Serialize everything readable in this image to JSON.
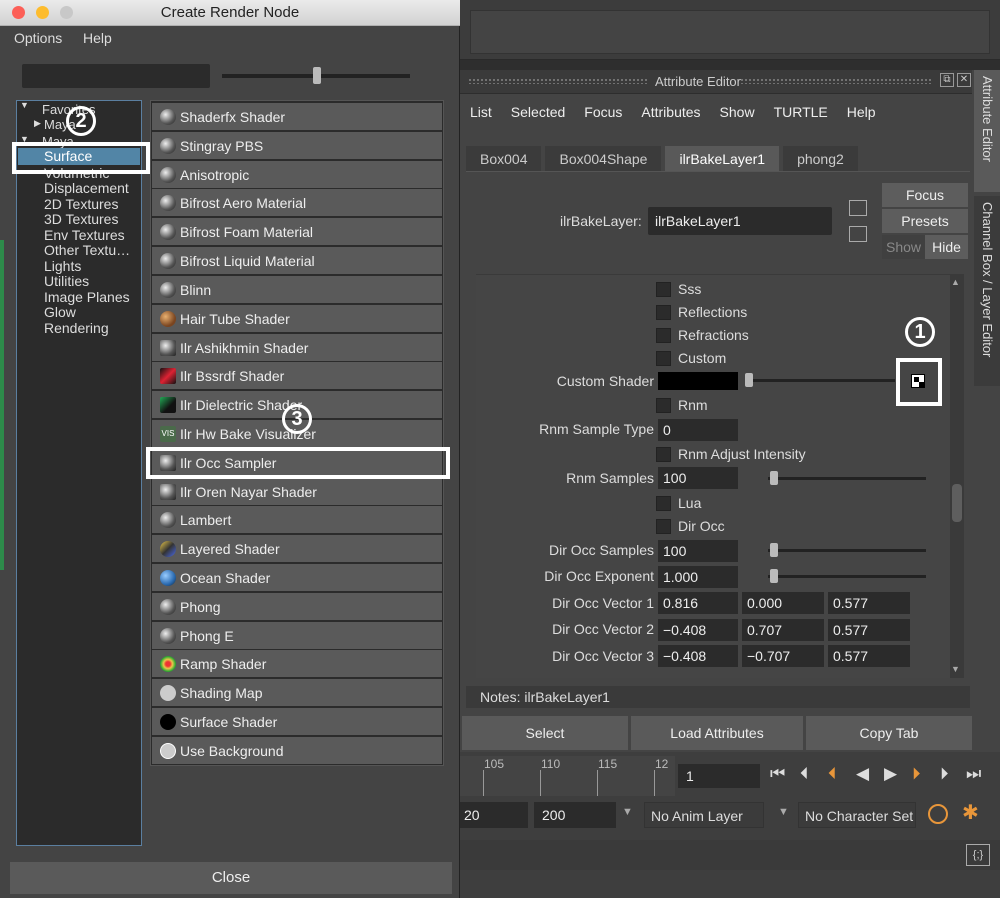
{
  "dialog": {
    "title": "Create Render Node",
    "menu": {
      "options": "Options",
      "help": "Help"
    },
    "tree": {
      "favorites": "Favorites",
      "maya_sub": "Maya",
      "maya": "Maya",
      "items": [
        "Surface",
        "Volumetric",
        "Displacement",
        "2D Textures",
        "3D Textures",
        "Env Textures",
        "Other Textu…",
        "Lights",
        "Utilities",
        "Image Planes",
        "Glow",
        "Rendering"
      ]
    },
    "shaders": [
      "Shaderfx Shader",
      "Stingray PBS",
      "Anisotropic",
      "Bifrost Aero Material",
      "Bifrost Foam Material",
      "Bifrost Liquid Material",
      "Blinn",
      "Hair Tube Shader",
      "Ilr Ashikhmin Shader",
      "Ilr Bssrdf Shader",
      "Ilr Dielectric Shader",
      "Ilr Hw Bake Visualizer",
      "Ilr Occ Sampler",
      "Ilr Oren Nayar Shader",
      "Lambert",
      "Layered Shader",
      "Ocean Shader",
      "Phong",
      "Phong E",
      "Ramp Shader",
      "Shading Map",
      "Surface Shader",
      "Use Background"
    ],
    "close": "Close"
  },
  "annotations": {
    "one": "1",
    "two": "2",
    "three": "3"
  },
  "attribute_editor": {
    "title": "Attribute Editor",
    "menu": [
      "List",
      "Selected",
      "Focus",
      "Attributes",
      "Show",
      "TURTLE",
      "Help"
    ],
    "tabs": [
      "Box004",
      "Box004Shape",
      "ilrBakeLayer1",
      "phong2"
    ],
    "node_label": "ilrBakeLayer:",
    "node_value": "ilrBakeLayer1",
    "focus": "Focus",
    "presets": "Presets",
    "show": "Show",
    "hide": "Hide",
    "checks": {
      "sss": "Sss",
      "reflections": "Reflections",
      "refractions": "Refractions",
      "custom": "Custom",
      "rnm": "Rnm",
      "rnm_adjust": "Rnm Adjust Intensity",
      "lua": "Lua",
      "dir_occ": "Dir Occ"
    },
    "custom_shader": "Custom Shader",
    "rnm_sample_type": {
      "label": "Rnm Sample Type",
      "value": "0"
    },
    "rnm_samples": {
      "label": "Rnm Samples",
      "value": "100"
    },
    "dir_occ_samples": {
      "label": "Dir Occ Samples",
      "value": "100"
    },
    "dir_occ_exponent": {
      "label": "Dir Occ Exponent",
      "value": "1.000"
    },
    "vectors": [
      {
        "label": "Dir Occ Vector 1",
        "values": [
          "0.816",
          "0.000",
          "0.577"
        ]
      },
      {
        "label": "Dir Occ Vector 2",
        "values": [
          "−0.408",
          "0.707",
          "0.577"
        ]
      },
      {
        "label": "Dir Occ Vector 3",
        "values": [
          "−0.408",
          "−0.707",
          "0.577"
        ]
      }
    ],
    "notes": "Notes:  ilrBakeLayer1",
    "buttons": {
      "select": "Select",
      "load": "Load Attributes",
      "copy": "Copy Tab"
    },
    "side_tabs": {
      "attribute_editor": "Attribute Editor",
      "channel_box": "Channel Box / Layer Editor"
    }
  },
  "timeline": {
    "ticks": [
      "105",
      "110",
      "115",
      "12"
    ],
    "current_frame": "1",
    "range_start": "20",
    "range_end": "200",
    "anim_layer": "No Anim Layer",
    "char_set": "No Character Set"
  }
}
